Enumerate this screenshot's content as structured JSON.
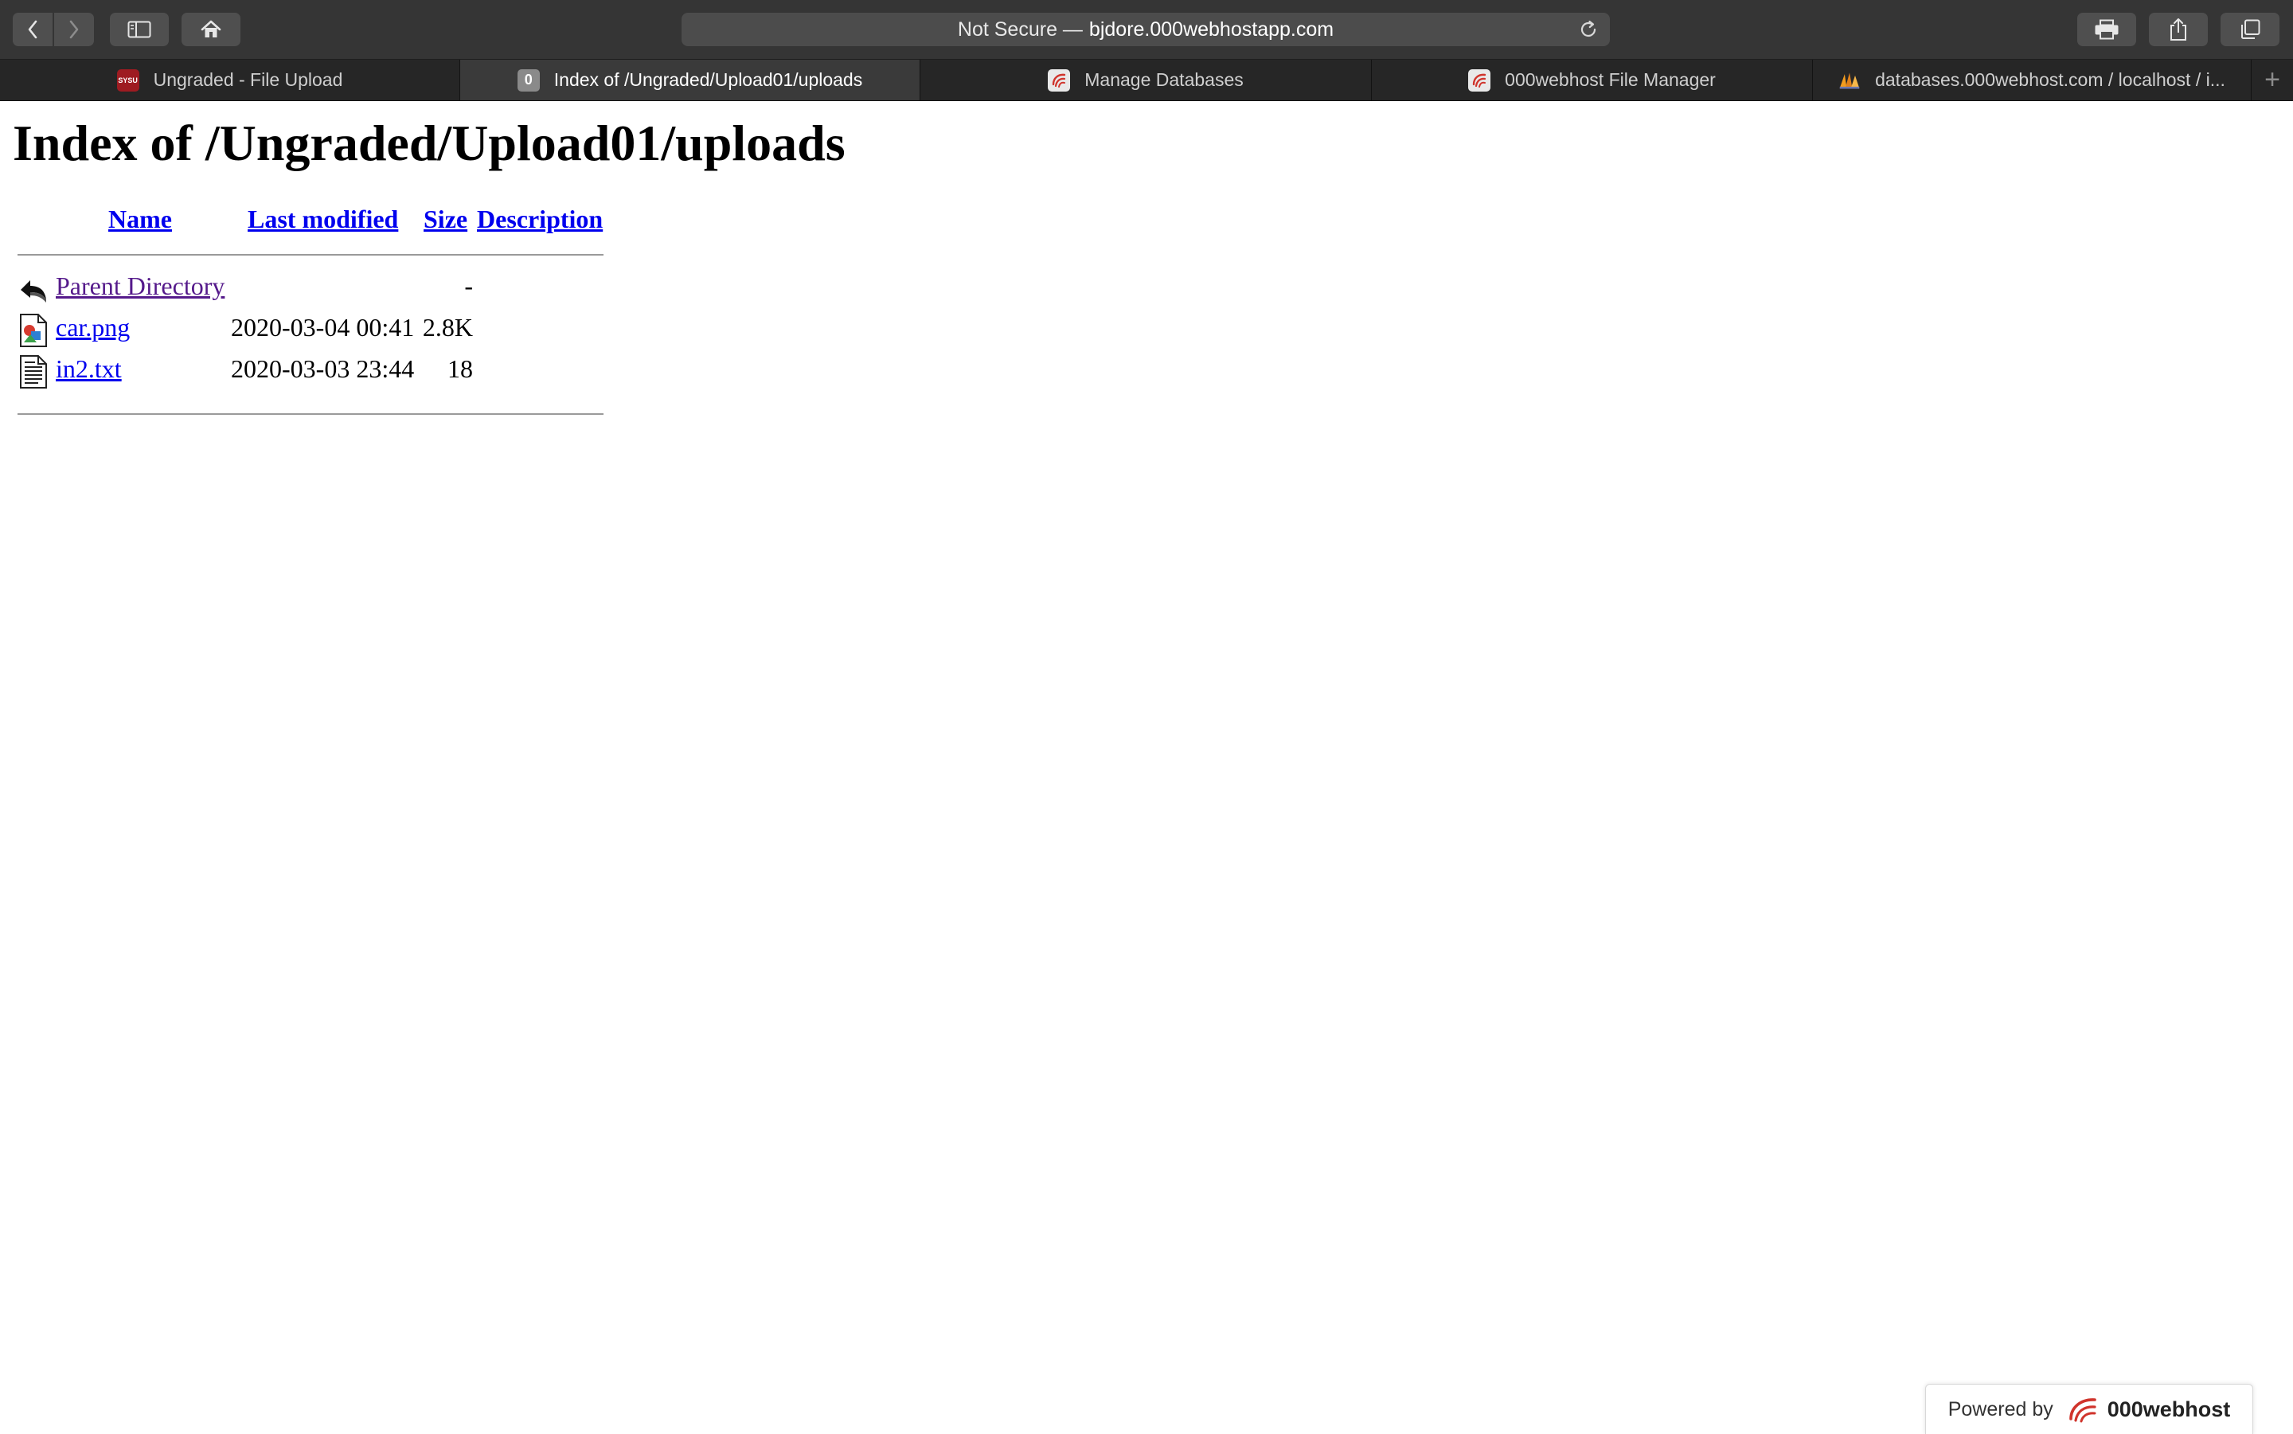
{
  "browser": {
    "url": {
      "prefix": "Not Secure —",
      "host": "bjdore.000webhostapp.com"
    },
    "tabs": [
      {
        "label": "Ungraded - File Upload",
        "favicon": "sysu-logo-icon",
        "active": false
      },
      {
        "label": "Index of /Ungraded/Upload01/uploads",
        "favicon": "zero-badge-icon",
        "favicon_text": "0",
        "active": true
      },
      {
        "label": "Manage Databases",
        "favicon": "webhost-icon",
        "active": false
      },
      {
        "label": "000webhost File Manager",
        "favicon": "webhost-icon",
        "active": false
      },
      {
        "label": "databases.000webhost.com / localhost / i...",
        "favicon": "phpmyadmin-icon",
        "active": false
      }
    ],
    "sysu_favicon_text": "SYSU"
  },
  "page": {
    "title": "Index of /Ungraded/Upload01/uploads",
    "columns": [
      "Name",
      "Last modified",
      "Size",
      "Description"
    ],
    "rows": [
      {
        "icon": "back-arrow-icon",
        "name": "Parent Directory",
        "modified": "",
        "size": "-",
        "visited": true
      },
      {
        "icon": "image-file-icon",
        "name": "car.png",
        "modified": "2020-03-04 00:41",
        "size": "2.8K",
        "visited": false
      },
      {
        "icon": "text-file-icon",
        "name": "in2.txt",
        "modified": "2020-03-03 23:44",
        "size": "18",
        "visited": false
      }
    ]
  },
  "footer": {
    "powered_by": "Powered by",
    "brand": "000webhost"
  },
  "colors": {
    "toolbar": "#353535",
    "tabstrip": "#262626",
    "link": "#0000ee",
    "visited_link": "#551a8b",
    "webhost_red": "#d0342c"
  }
}
